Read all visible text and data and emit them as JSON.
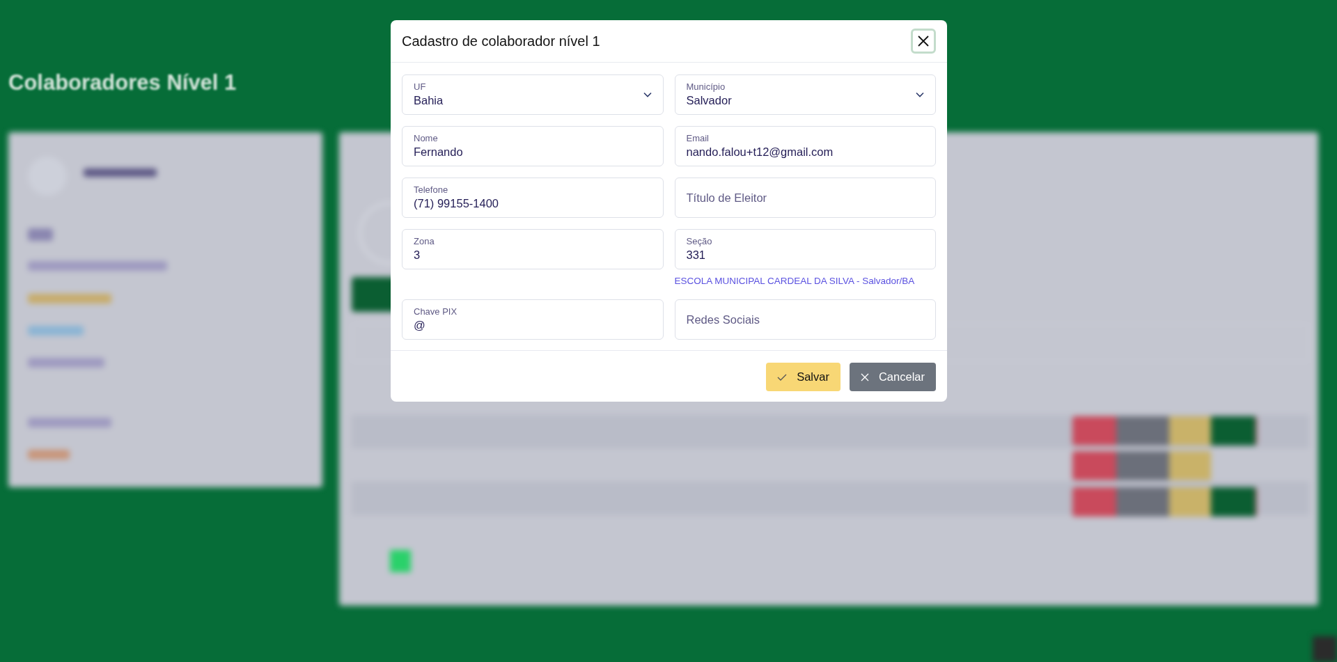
{
  "page": {
    "title": "Colaboradores Nível 1"
  },
  "dialog": {
    "title": "Cadastro de colaborador nível 1",
    "fields": [
      {
        "kind": "select",
        "label": "UF",
        "value": "Bahia"
      },
      {
        "kind": "select",
        "label": "Município",
        "value": "Salvador"
      },
      {
        "kind": "input",
        "label": "Nome",
        "value": "Fernando"
      },
      {
        "kind": "input",
        "label": "Email",
        "value": "nando.falou+t12@gmail.com"
      },
      {
        "kind": "input",
        "label": "Telefone",
        "value": "(71) 99155-1400"
      },
      {
        "kind": "input",
        "placeholder": "Título de Eleitor"
      },
      {
        "kind": "input",
        "label": "Zona",
        "value": "3"
      },
      {
        "kind": "input",
        "label": "Seção",
        "value": "331",
        "helper": "ESCOLA MUNICIPAL CARDEAL DA SILVA - Salvador/BA"
      },
      {
        "kind": "input",
        "label": "Chave PIX",
        "value": "@"
      },
      {
        "kind": "input",
        "placeholder": "Redes Sociais"
      }
    ],
    "buttons": [
      {
        "kind": "save",
        "label": "Salvar"
      },
      {
        "kind": "cancel",
        "label": "Cancelar"
      }
    ]
  }
}
